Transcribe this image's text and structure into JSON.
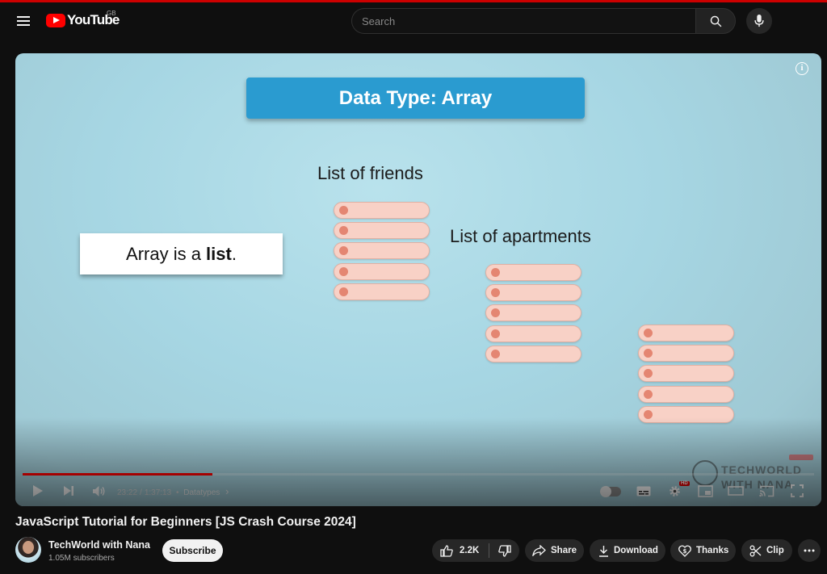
{
  "header": {
    "logo_text": "YouTube",
    "country_code": "GB",
    "search_placeholder": "Search"
  },
  "video": {
    "slide_title": "Data Type: Array",
    "caption_friends": "List of friends",
    "caption_apartments": "List of apartments",
    "array_box_prefix": "Array is a ",
    "array_box_bold": "list",
    "array_box_suffix": ".",
    "watermark_line1": "TECHWORLD",
    "watermark_line2": "WITH NANA",
    "info_label": "i"
  },
  "player": {
    "current_time": "23:22",
    "duration": "1:37:13",
    "separator": "/",
    "bullet": "•",
    "chapter": "Datatypes",
    "chapter_chevron": "›",
    "hd_label": "HD",
    "progress_played": 0.24,
    "progress_buffered": 0.0,
    "accent_color": "#ff0000"
  },
  "meta": {
    "title": "JavaScript Tutorial for Beginners [JS Crash Course 2024]",
    "channel_name": "TechWorld with Nana",
    "subscribers": "1.05M subscribers",
    "subscribe_label": "Subscribe",
    "likes": "2.2K",
    "share_label": "Share",
    "download_label": "Download",
    "thanks_label": "Thanks",
    "clip_label": "Clip"
  }
}
